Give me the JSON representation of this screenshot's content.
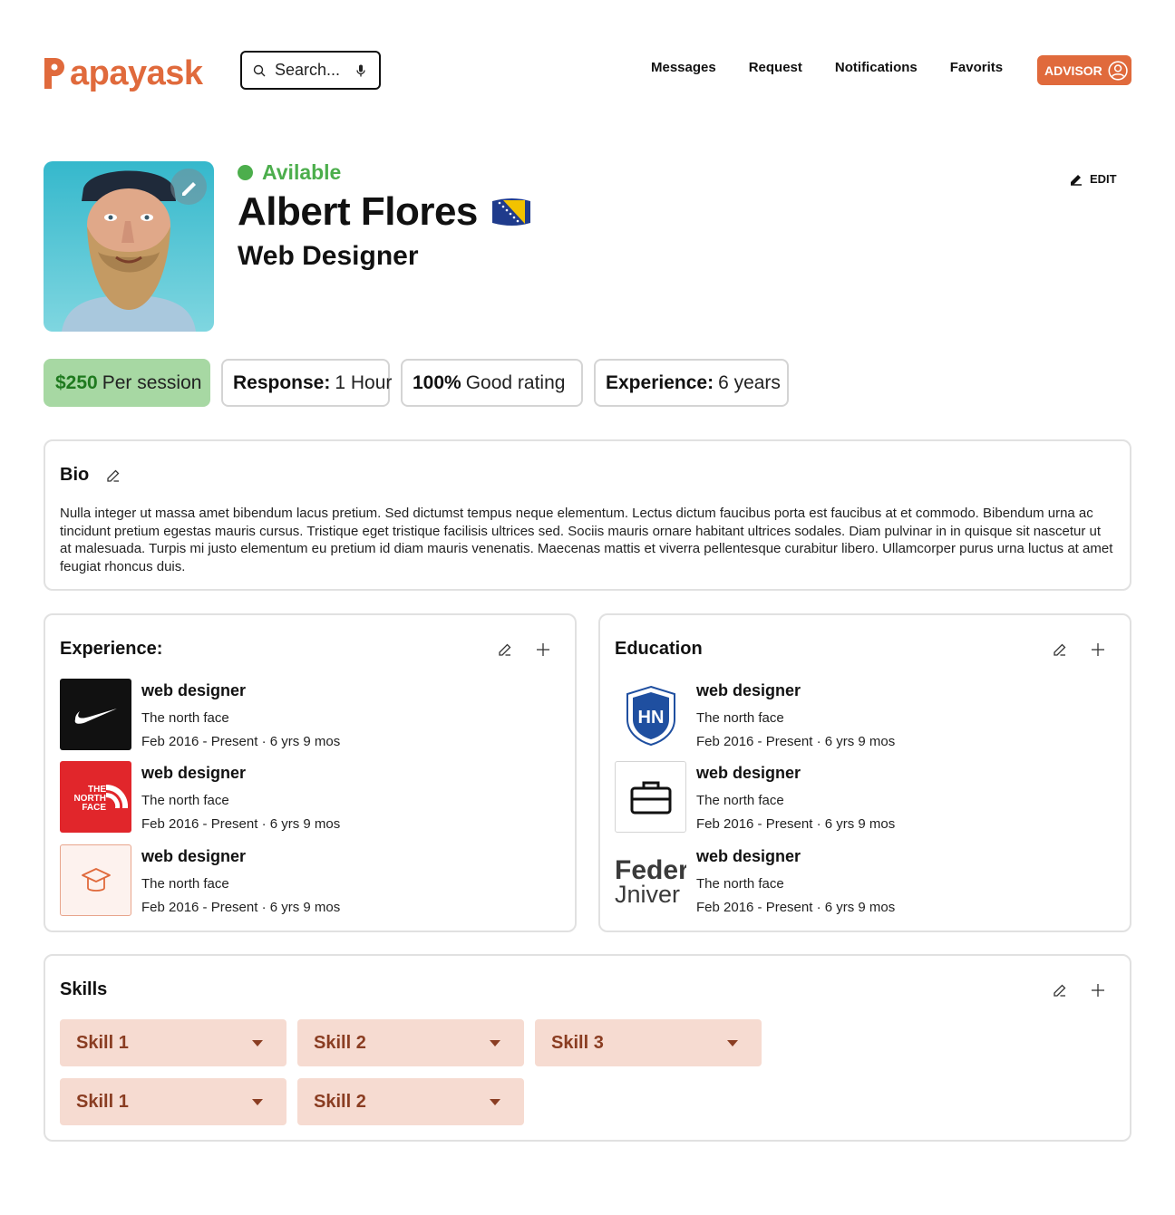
{
  "header": {
    "logo_text": "apayask",
    "search_placeholder": "Search...",
    "nav": [
      "Messages",
      "Request",
      "Notifications",
      "Favorits"
    ],
    "advisor_label": "ADVISOR",
    "accent_color": "#e06a3c"
  },
  "profile": {
    "status": "Avilable",
    "status_color": "#4cae4c",
    "name": "Albert Flores",
    "role": "Web Designer",
    "edit_label": "EDIT"
  },
  "stats": [
    {
      "bold": "$250",
      "text": "Per session"
    },
    {
      "bold": "Response:",
      "text": "1 Hour"
    },
    {
      "bold": "100%",
      "text": "Good rating"
    },
    {
      "bold": "Experience:",
      "text": "6 years"
    }
  ],
  "bio": {
    "title": "Bio",
    "text": "Nulla integer ut massa amet bibendum lacus pretium. Sed dictumst tempus neque elementum. Lectus dictum faucibus porta est faucibus at et commodo. Bibendum urna ac tincidunt pretium egestas mauris cursus. Tristique eget tristique facilisis ultrices sed. Sociis mauris ornare habitant ultrices sodales. Diam pulvinar in in quisque sit nascetur ut at malesuada. Turpis mi justo elementum eu pretium id diam mauris venenatis. Maecenas mattis et viverra pellentesque curabitur libero. Ullamcorper purus urna luctus at amet feugiat rhoncus duis."
  },
  "experience": {
    "title": "Experience:",
    "items": [
      {
        "title": "web designer",
        "org": "The north face",
        "date": "Feb 2016 - Present · 6 yrs 9 mos",
        "logo": "nike-logo"
      },
      {
        "title": "web designer",
        "org": "The north face",
        "date": "Feb 2016 - Present · 6 yrs 9 mos",
        "logo": "north-face-logo",
        "logo_text": [
          "THE",
          "NORTH",
          "FACE"
        ]
      },
      {
        "title": "web designer",
        "org": "The north face",
        "date": "Feb 2016 - Present · 6 yrs 9 mos",
        "logo": "graduation-cap-icon"
      }
    ]
  },
  "education": {
    "title": "Education",
    "items": [
      {
        "title": "web designer",
        "org": "The north face",
        "date": "Feb 2016 - Present · 6 yrs 9 mos",
        "logo": "university-seal",
        "logo_text": "HN"
      },
      {
        "title": "web designer",
        "org": "The north face",
        "date": "Feb 2016 - Present · 6 yrs 9 mos",
        "logo": "briefcase-icon"
      },
      {
        "title": "web designer",
        "org": "The north face",
        "date": "Feb 2016 - Present · 6 yrs 9 mos",
        "logo": "federal-university-logo",
        "logo_text": [
          "Feder",
          "Jniver"
        ]
      }
    ]
  },
  "skills": {
    "title": "Skills",
    "items": [
      "Skill 1",
      "Skill 2",
      "Skill 3",
      "Skill 1",
      "Skill 2"
    ]
  }
}
